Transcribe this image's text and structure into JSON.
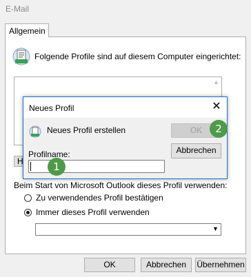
{
  "window": {
    "title": "E-Mail"
  },
  "tabs": [
    {
      "label": "Allgemein"
    }
  ],
  "main": {
    "intro_text": "Folgende Profile sind auf diesem Computer eingerichtet:",
    "hidden_button_prefix": "H",
    "start_label": "Beim Start von Microsoft Outlook dieses Profil verwenden:",
    "radio_prompt_label": "Zu verwendendes Profil bestätigen",
    "radio_always_label": "Immer dieses Profil verwenden",
    "radio_selected": "always",
    "profile_combo_value": ""
  },
  "footer": {
    "ok_label": "OK",
    "cancel_label": "Abbrechen",
    "apply_label": "Übernehmen"
  },
  "dialog": {
    "title": "Neues Profil",
    "close_glyph": "✕",
    "heading": "Neues Profil erstellen",
    "ok_label": "OK",
    "cancel_label": "Abbrechen",
    "field_label": "Profilname:",
    "field_value": ""
  },
  "badges": [
    {
      "label": "1"
    },
    {
      "label": "2"
    }
  ],
  "colors": {
    "badge": "#4f9a4a",
    "dialog_border": "#1c6ec7"
  }
}
